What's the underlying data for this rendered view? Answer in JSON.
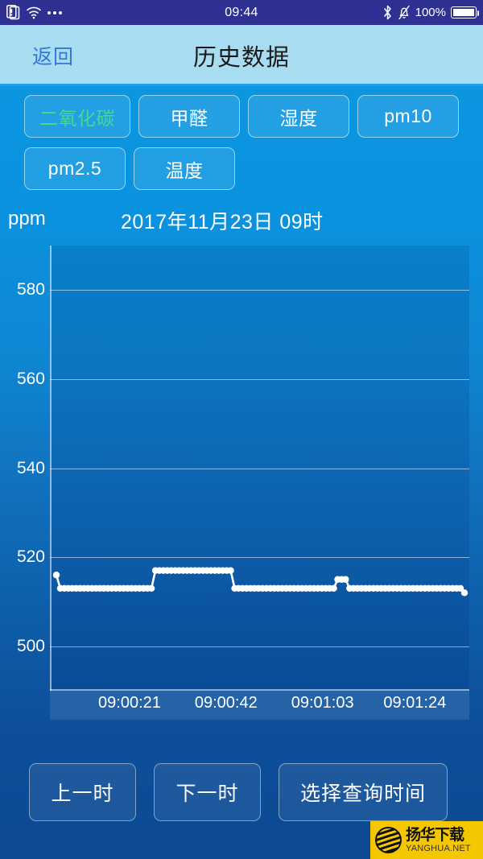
{
  "status_bar": {
    "time": "09:44",
    "battery_percent": "100%",
    "icons_left": [
      "sim-card-alert-icon",
      "wifi-icon",
      "more-dots-icon"
    ],
    "icons_right": [
      "bluetooth-icon",
      "bell-muted-icon",
      "battery-icon"
    ]
  },
  "nav": {
    "back_label": "返回",
    "title": "历史数据"
  },
  "tabs": [
    {
      "label": "二氧化碳",
      "active": true
    },
    {
      "label": "甲醛",
      "active": false
    },
    {
      "label": "湿度",
      "active": false
    },
    {
      "label": "pm10",
      "active": false
    },
    {
      "label": "pm2.5",
      "active": false
    },
    {
      "label": "温度",
      "active": false
    }
  ],
  "chart_data": {
    "type": "line",
    "title": "2017年11月23日 09时",
    "unit_label": "ppm",
    "ylabel": "ppm",
    "xlabel": "",
    "ylim": [
      490,
      590
    ],
    "yticks": [
      500,
      520,
      540,
      560,
      580
    ],
    "xtick_labels": [
      "09:00:21",
      "09:00:42",
      "09:01:03",
      "09:01:24"
    ],
    "xtick_positions": [
      0.19,
      0.42,
      0.65,
      0.87
    ],
    "grid": true,
    "legend": "none",
    "line_color": "#ffffff",
    "marker": "circle",
    "series": [
      {
        "name": "二氧化碳",
        "values": [
          516,
          513,
          513,
          513,
          513,
          513,
          513,
          513,
          513,
          513,
          513,
          513,
          513,
          513,
          513,
          513,
          513,
          513,
          513,
          513,
          513,
          513,
          513,
          513,
          513,
          517,
          517,
          517,
          517,
          517,
          517,
          517,
          517,
          517,
          517,
          517,
          517,
          517,
          517,
          517,
          517,
          517,
          517,
          517,
          517,
          513,
          513,
          513,
          513,
          513,
          513,
          513,
          513,
          513,
          513,
          513,
          513,
          513,
          513,
          513,
          513,
          513,
          513,
          513,
          513,
          513,
          513,
          513,
          513,
          513,
          513,
          515,
          515,
          515,
          513,
          513,
          513,
          513,
          513,
          513,
          513,
          513,
          513,
          513,
          513,
          513,
          513,
          513,
          513,
          513,
          513,
          513,
          513,
          513,
          513,
          513,
          513,
          513,
          513,
          513,
          513,
          513,
          513,
          512
        ]
      }
    ]
  },
  "footer_buttons": [
    {
      "label": "上一时",
      "name": "prev-hour-button"
    },
    {
      "label": "下一时",
      "name": "next-hour-button"
    },
    {
      "label": "选择查询时间",
      "name": "pick-time-button"
    }
  ],
  "watermark": {
    "cn": "扬华下载",
    "en": "YANGHUA.NET"
  },
  "colors": {
    "accent_active_tab": "#46d98b",
    "navbar": "#a8dcf0",
    "statusbar": "#2f3192",
    "back_link": "#3377d8",
    "watermark_bg": "#f5c700"
  }
}
